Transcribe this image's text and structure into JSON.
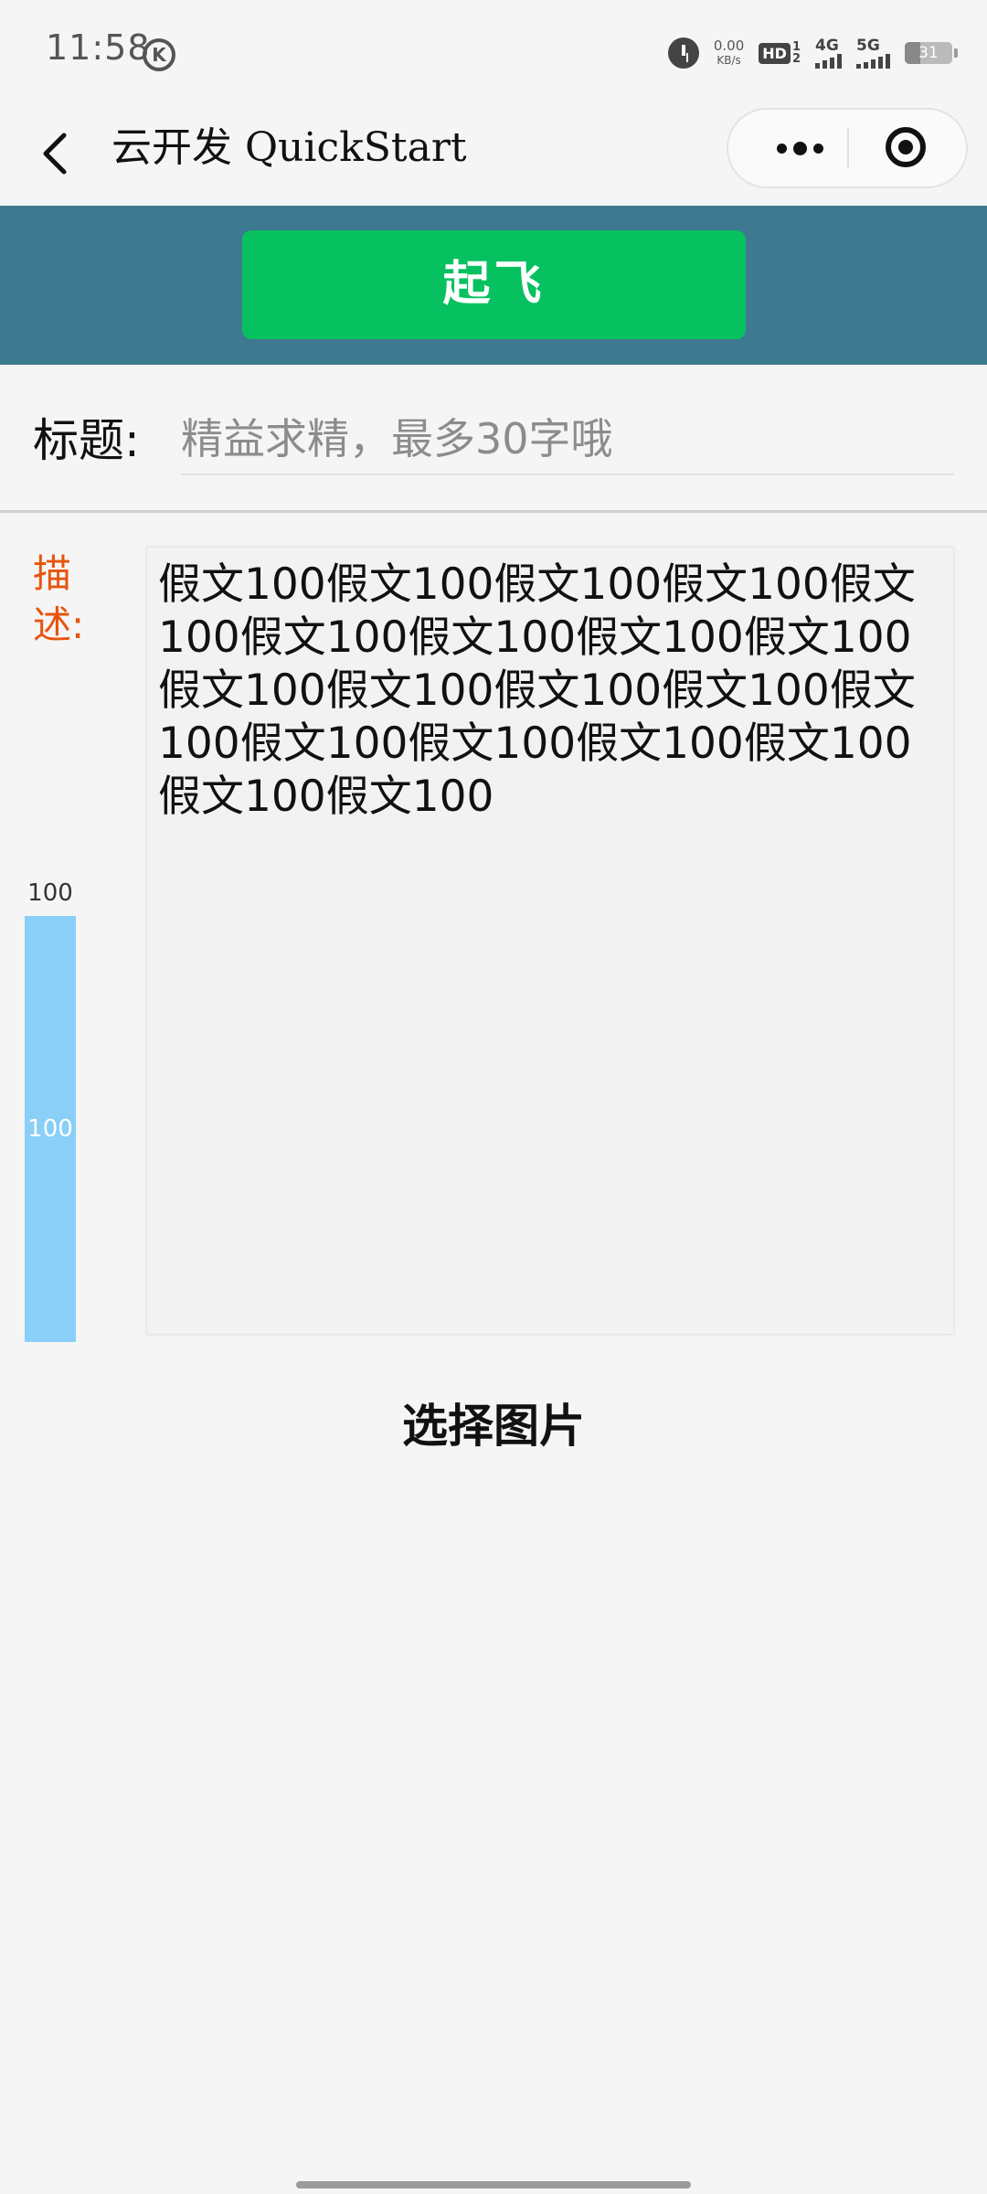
{
  "status_bar": {
    "time": "11:58",
    "k_badge": "K",
    "net_speed_value": "0.00",
    "net_speed_unit": "KB/s",
    "hd_label": "HD",
    "hd_sub1": "1",
    "hd_sub2": "2",
    "sig1_label": "4G",
    "sig2_label": "5G",
    "battery": "31"
  },
  "nav": {
    "title": "云开发 QuickStart"
  },
  "actions": {
    "takeoff_label": "起飞",
    "choose_image_label": "选择图片"
  },
  "form": {
    "title_label": "标题:",
    "title_value": "",
    "title_placeholder": "精益求精，最多30字哦",
    "desc_label": "描述:",
    "desc_text": "假文100假文100假文100假文100假文100假文100假文100假文100假文100假文100假文100假文100假文100假文100假文100假文100假文100假文100假文100假文100"
  },
  "progress": {
    "top_label": "100",
    "mid_label": "100",
    "value_percent": 100
  },
  "colors": {
    "band": "#3d7a90",
    "button_green": "#07c160",
    "desc_label": "#e8540d",
    "progress_fill": "#89cff8"
  }
}
